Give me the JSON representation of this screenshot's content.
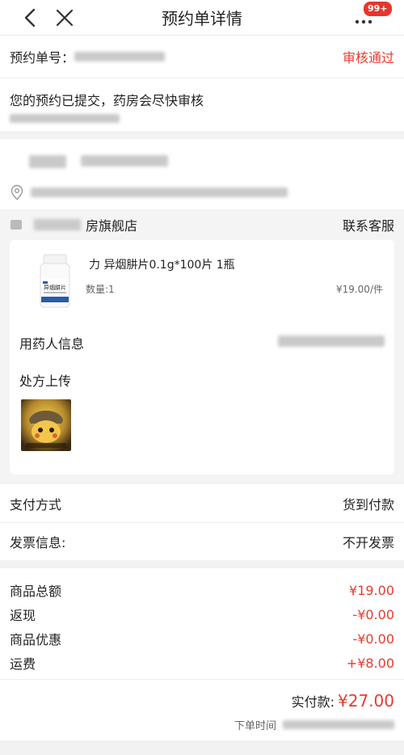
{
  "nav": {
    "title": "预约单详情",
    "badge": "99+"
  },
  "order": {
    "number_label": "预约单号：",
    "status": "审核通过"
  },
  "submit": {
    "message": "您的预约已提交，药房会尽快审核"
  },
  "store": {
    "name_suffix": "房旗舰店",
    "service": "联系客服"
  },
  "product": {
    "name": "力 异烟肼片0.1g*100片 1瓶",
    "quantity": "数量:1",
    "price": "¥19.00/件",
    "image_label": "异烟肼片"
  },
  "patient": {
    "label": "用药人信息"
  },
  "prescription": {
    "label": "处方上传"
  },
  "payment": {
    "label": "支付方式",
    "value": "货到付款"
  },
  "invoice": {
    "label": "发票信息:",
    "value": "不开发票"
  },
  "amounts": {
    "goods_total_label": "商品总额",
    "goods_total_value": "¥19.00",
    "cashback_label": "返现",
    "cashback_value": "-¥0.00",
    "discount_label": "商品优惠",
    "discount_value": "-¥0.00",
    "shipping_label": "运费",
    "shipping_value": "+¥8.00"
  },
  "total": {
    "label": "实付款:",
    "value": "¥27.00",
    "order_time_label": "下单时间"
  },
  "colors": {
    "accent": "#e63b2e",
    "badge": "#e8352c"
  },
  "icons": [
    "back-arrow-icon",
    "close-icon",
    "more-dots-icon",
    "location-pin-icon",
    "store-icon"
  ]
}
